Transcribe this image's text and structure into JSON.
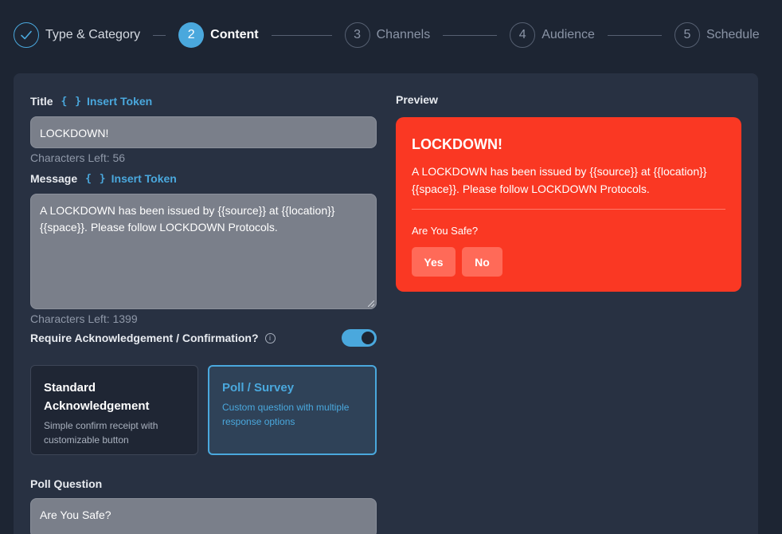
{
  "stepper": {
    "steps": [
      {
        "label": "Type & Category",
        "number": "",
        "state": "done"
      },
      {
        "label": "Content",
        "number": "2",
        "state": "active"
      },
      {
        "label": "Channels",
        "number": "3",
        "state": "todo"
      },
      {
        "label": "Audience",
        "number": "4",
        "state": "todo"
      },
      {
        "label": "Schedule",
        "number": "5",
        "state": "todo"
      }
    ]
  },
  "form": {
    "title_label": "Title",
    "insert_token": "Insert Token",
    "title_value": "LOCKDOWN!",
    "title_chars_left": "Characters Left: 56",
    "message_label": "Message",
    "message_value": "A LOCKDOWN has been issued by {{source}} at {{location}} {{space}}. Please follow LOCKDOWN Protocols.",
    "message_chars_left": "Characters Left: 1399",
    "ack_label": "Require Acknowledgement / Confirmation?",
    "ack_enabled": true,
    "options": [
      {
        "title": "Standard Acknowledgement",
        "desc": "Simple confirm receipt with customizable button",
        "selected": false
      },
      {
        "title": "Poll / Survey",
        "desc": "Custom question with multiple response options",
        "selected": true
      }
    ],
    "poll_label": "Poll Question",
    "poll_value": "Are You Safe?"
  },
  "preview": {
    "label": "Preview",
    "title": "LOCKDOWN!",
    "message": "A LOCKDOWN has been issued by {{source}} at {{location}} {{space}}. Please follow LOCKDOWN Protocols.",
    "question": "Are You Safe?",
    "buttons": [
      "Yes",
      "No"
    ]
  },
  "colors": {
    "accent": "#4aa8dd",
    "alert": "#fa3823",
    "background": "#1d2533",
    "card": "#283142"
  },
  "icons": [
    "check-icon",
    "braces-icon",
    "info-icon"
  ]
}
